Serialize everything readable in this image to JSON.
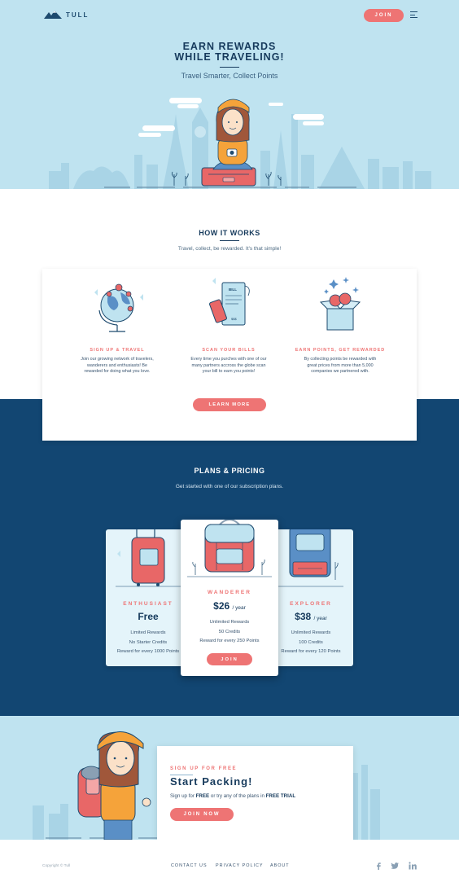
{
  "nav": {
    "brand": "TULL",
    "join_label": "JOIN"
  },
  "hero": {
    "title_line1": "EARN REWARDS",
    "title_line2": "WHILE TRAVELING!",
    "subtitle": "Travel Smarter, Collect Points"
  },
  "how": {
    "title": "HOW IT WORKS",
    "subtitle": "Travel, collect, be rewarded. It's that simple!",
    "features": [
      {
        "title": "SIGN UP & TRAVEL",
        "desc_lines": [
          "Join our growing network of travelers,",
          "wanderers and enthusiasts! Be",
          "rewarded for doing what you love."
        ]
      },
      {
        "title": "SCAN YOUR BILLS",
        "desc_lines": [
          "Every time you purches with one of our",
          "many partners accross the globe scan",
          "your bill to earn you points!"
        ],
        "bill_label": "BILL",
        "bill_amount": "$$$"
      },
      {
        "title": "EARN POINTS, GET REWARDED",
        "desc_lines": [
          "By collecting points be rewarded with",
          "great prices from more than 5,000",
          "companies we partnered with."
        ]
      }
    ],
    "learn_more": "LEARN MORE"
  },
  "plans": {
    "title": "PLANS & PRICING",
    "subtitle": "Get started with one of our subscription plans.",
    "items": [
      {
        "name": "ENTHUSIAST",
        "price": "Free",
        "period": "",
        "features": [
          "Limited Rewards",
          "No Starter Credits",
          "Reward for every 1000 Points"
        ]
      },
      {
        "name": "WANDERER",
        "price": "$26",
        "period": "/ year",
        "features": [
          "Unlimited Rewards",
          "50 Credits",
          "Reward for every 250 Points"
        ],
        "join_label": "JOIN"
      },
      {
        "name": "EXPLORER",
        "price": "$38",
        "period": "/ year",
        "features": [
          "Unlimited Rewards",
          "100 Credits",
          "Reward for every 120 Points"
        ]
      }
    ]
  },
  "signup": {
    "kicker": "SIGN UP FOR FREE",
    "title": "Start Packing!",
    "text_pre": "Sign up for ",
    "text_free": "FREE",
    "text_mid": " or try any of the plans in ",
    "text_trial": "FREE TRIAL",
    "button": "JOIN NOW"
  },
  "footer": {
    "copyright": "Copyright © Tull",
    "links": [
      "CONTACT US",
      "PRIVACY POLICY",
      "ABOUT"
    ]
  },
  "colors": {
    "accent": "#ee7474",
    "navy": "#124672",
    "sky": "#bfe3f0",
    "ink": "#163a5c"
  },
  "icons": [
    "mountain-logo-icon",
    "menu-icon",
    "globe-icon",
    "bill-icon",
    "gift-box-icon",
    "suitcase-icon",
    "backpack-icon",
    "facebook-icon",
    "twitter-icon",
    "linkedin-icon"
  ]
}
